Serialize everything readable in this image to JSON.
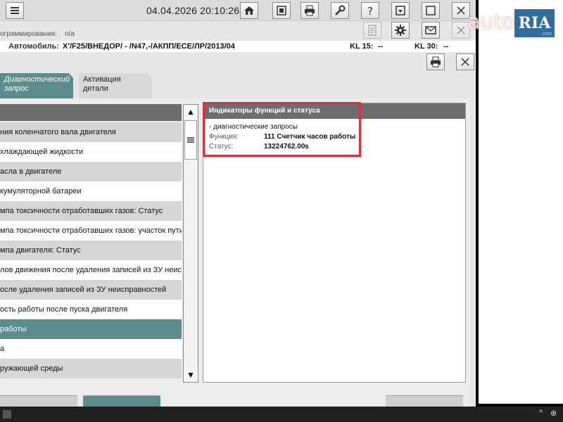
{
  "toolbar": {
    "datetime": "04.04.2026 20:10:26",
    "buttons": [
      "menu-icon",
      "home-icon",
      "vehicle-icon",
      "print-icon",
      "wrench-icon",
      "help-icon",
      "download-icon",
      "window-icon",
      "close-icon"
    ]
  },
  "programming": {
    "label": "ограммирования:",
    "value": "n/a"
  },
  "vehicle": {
    "label": "Автомобиль:",
    "value": "X'/F25/ВНЕДОР/ - /N47,-/АКПП/ECE/ЛР/2013/04",
    "kl15_label": "KL 15:",
    "kl15_value": "--",
    "kl30_label": "KL 30:",
    "kl30_value": "--"
  },
  "tabs": [
    {
      "label": "Диагностический запрос"
    },
    {
      "label": "Активация детали"
    }
  ],
  "list_items": [
    "ния коленчатого вала двигателя",
    "хлаждающей жидкости",
    "асла в двигателе",
    "кумуляторной батареи",
    "мпа токсичности отработавших газов: Статус",
    "мпа токсичности отработавших газов: участок пути",
    "мпа двигателя: Статус",
    "лов движения после удаления записей из ЗУ неис",
    "осле удаления записей из ЗУ неисправностей",
    "ость работы после пуска двигателя",
    "работы",
    "а",
    "ружающей среды"
  ],
  "detail": {
    "title": "Индикаторы функций и статуса",
    "subtitle": "- диагностические запросы",
    "function_label": "Функция:",
    "function_value": "111 Счетчик часов работы",
    "status_label": "Статус:",
    "status_value": "13224762.00",
    "status_unit": "s"
  },
  "watermark": {
    "auto": "auto",
    "ria": "RIA",
    "com": ".com"
  },
  "colors": {
    "accent": "#5c8c8c",
    "highlight": "#d9303a",
    "header": "#6e6e6e"
  }
}
